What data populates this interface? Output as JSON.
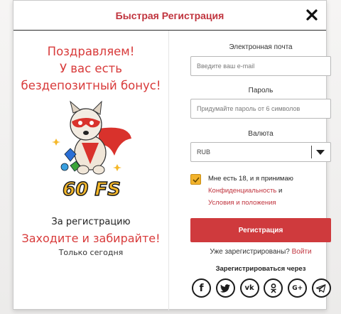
{
  "modal": {
    "title": "Быстрая Регистрация"
  },
  "promo": {
    "lines": [
      "Поздравляем!",
      "У вас есть",
      "бездепозитный бонус!"
    ],
    "badge": "60 FS",
    "subtitle": "За регистрацию",
    "cta": "Заходите и забирайте!",
    "note": "Только сегодня"
  },
  "form": {
    "email": {
      "label": "Электронная почта",
      "placeholder": "Введите ваш e-mail",
      "value": ""
    },
    "password": {
      "label": "Пароль",
      "placeholder": "Придумайте пароль от 6 символов",
      "value": ""
    },
    "currency": {
      "label": "Валюта",
      "selected": "RUB"
    },
    "consent": {
      "checked": true,
      "text_prefix": "Мне есть 18, и я принимаю",
      "privacy_link": "Конфиденциальность",
      "conjunction": "и",
      "terms_link": "Условия и положения"
    },
    "submit_label": "Регистрация",
    "already_text": "Уже зарегистрированы?",
    "login_link": "Войти"
  },
  "social": {
    "title": "Зарегистрироваться через",
    "buttons": [
      {
        "name": "facebook",
        "glyph": "f"
      },
      {
        "name": "twitter",
        "glyph": ""
      },
      {
        "name": "vk",
        "glyph": "vk"
      },
      {
        "name": "odnoklassniki",
        "glyph": ""
      },
      {
        "name": "google-plus",
        "glyph": "G+"
      },
      {
        "name": "telegram",
        "glyph": ""
      }
    ]
  },
  "colors": {
    "accent": "#cf3a3d",
    "title": "#c0343e",
    "checkbox": "#f2b32c"
  }
}
